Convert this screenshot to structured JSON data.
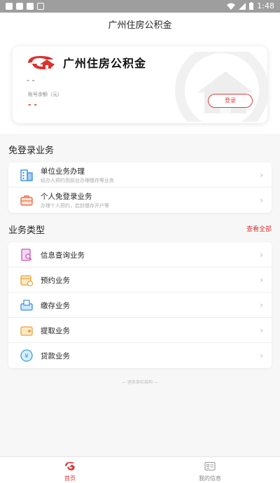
{
  "status_bar": {
    "time": "1:48"
  },
  "header": {
    "title": "广州住房公积金"
  },
  "account_card": {
    "brand": "广州住房公积金",
    "name_placeholder": "- -",
    "balance_label": "账号余额（元）",
    "balance_value": "- -",
    "login_label": "登录"
  },
  "guest_section": {
    "title": "免登录业务",
    "items": [
      {
        "title": "单位业务办理",
        "desc": "经办人预约到前台办理缴存等业务",
        "icon": "building-icon"
      },
      {
        "title": "个人免登录业务",
        "desc": "办理个人预约，启封缴存开户等",
        "icon": "briefcase-icon"
      }
    ]
  },
  "business_section": {
    "title": "业务类型",
    "view_all": "查看全部",
    "items": [
      {
        "title": "信息查询业务",
        "icon": "document-search-icon"
      },
      {
        "title": "预约业务",
        "icon": "calendar-icon"
      },
      {
        "title": "缴存业务",
        "icon": "deposit-icon"
      },
      {
        "title": "提取业务",
        "icon": "wallet-icon"
      },
      {
        "title": "贷款业务",
        "icon": "yuan-coin-icon"
      }
    ]
  },
  "footnote": "— 竖条各栏结构 —",
  "tab_bar": {
    "tabs": [
      {
        "label": "首页",
        "icon": "home-logo-icon",
        "active": true
      },
      {
        "label": "我的信息",
        "icon": "id-card-icon",
        "active": false
      }
    ]
  },
  "colors": {
    "accent": "#d33a3a",
    "text": "#222222",
    "muted": "#aaaaaa"
  }
}
